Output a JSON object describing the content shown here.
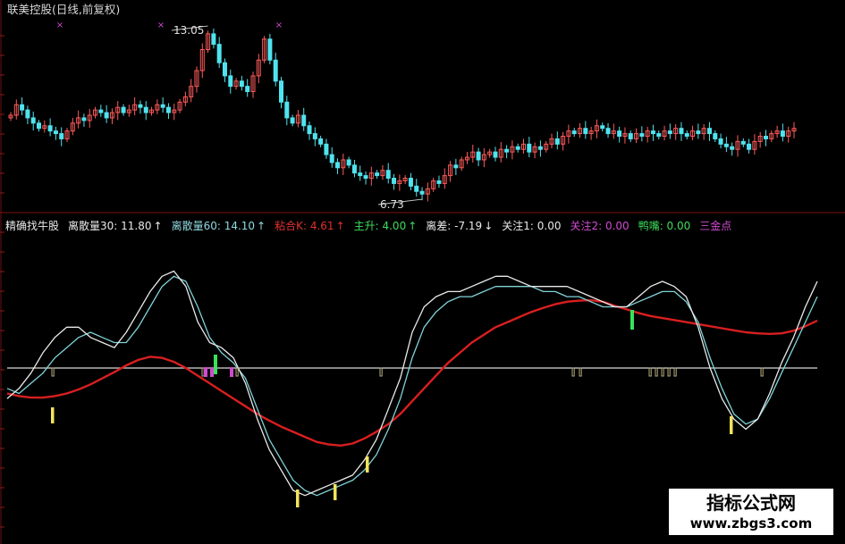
{
  "colors": {
    "background": "#000000",
    "divider": "#7a1212",
    "candle_up": "#ff5a5a",
    "candle_down": "#4fe3ef",
    "line_white": "#eaeaea",
    "line_cyan": "#7fd3d8",
    "line_red": "#d81f1f",
    "zero_line": "#d9d9d9",
    "tick_tan": "#b6ad7c",
    "mark_yellow": "#f2e35c",
    "mark_green": "#38e05c",
    "mark_magenta": "#d04ad0",
    "title_color": "#d8d8d8",
    "label_color": "#e0e0e0"
  },
  "price_panel": {
    "title": "联美控股(日线,前复权)",
    "high_label": "13.05",
    "low_label": "6.73",
    "marker_symbol": "×"
  },
  "indicator_bar": {
    "items": [
      {
        "text": "精确找牛股",
        "color": "#e8e8e8",
        "arrow": ""
      },
      {
        "text": "离散量30: 11.80",
        "color": "#e8e8e8",
        "arrow": "↑"
      },
      {
        "text": "离散量60: 14.10",
        "color": "#8fd9e0",
        "arrow": "↑"
      },
      {
        "text": "粘合K: 4.61",
        "color": "#e03030",
        "arrow": "↑"
      },
      {
        "text": "主升: 4.00",
        "color": "#3ddc5a",
        "arrow": "↑"
      },
      {
        "text": "离差: -7.19",
        "color": "#e8e8e8",
        "arrow": "↓"
      },
      {
        "text": "关注1: 0.00",
        "color": "#e8e8e8",
        "arrow": ""
      },
      {
        "text": "关注2: 0.00",
        "color": "#d04ad0",
        "arrow": ""
      },
      {
        "text": "鸭嘴: 0.00",
        "color": "#3ddc5a",
        "arrow": ""
      },
      {
        "text": "三金点",
        "color": "#d04ad0",
        "arrow": ""
      }
    ]
  },
  "watermark": {
    "name": "指标公式网",
    "url": "www.zbgs3.com"
  },
  "chart_data": [
    {
      "type": "candlestick",
      "title": "联美控股(日线,前复权)",
      "annotations": [
        {
          "label": "13.05",
          "value": 13.05,
          "kind": "high"
        },
        {
          "label": "6.73",
          "value": 6.73,
          "kind": "low"
        }
      ],
      "close_series": [
        9.9,
        10.3,
        10.1,
        9.8,
        9.6,
        9.4,
        9.5,
        9.3,
        9.2,
        9.0,
        9.3,
        9.6,
        9.8,
        9.7,
        9.9,
        10.1,
        10.0,
        9.8,
        10.0,
        10.2,
        10.0,
        10.1,
        10.3,
        10.2,
        10.0,
        10.1,
        10.3,
        10.2,
        10.0,
        10.1,
        10.4,
        10.6,
        11.0,
        11.6,
        12.4,
        13.0,
        12.6,
        11.9,
        11.4,
        11.0,
        11.2,
        11.0,
        10.8,
        11.4,
        12.0,
        12.8,
        12.0,
        11.2,
        10.4,
        9.8,
        9.6,
        9.9,
        9.5,
        9.2,
        9.0,
        8.8,
        8.4,
        8.1,
        7.9,
        8.2,
        8.0,
        7.7,
        7.6,
        7.5,
        7.7,
        7.6,
        7.8,
        7.5,
        7.3,
        7.4,
        7.5,
        7.2,
        7.0,
        6.9,
        7.1,
        7.4,
        7.3,
        7.6,
        8.0,
        7.9,
        8.2,
        8.3,
        8.5,
        8.2,
        8.4,
        8.5,
        8.3,
        8.6,
        8.5,
        8.7,
        8.6,
        8.8,
        8.5,
        8.7,
        8.6,
        8.8,
        9.0,
        8.8,
        9.1,
        9.3,
        9.2,
        9.4,
        9.2,
        9.3,
        9.5,
        9.4,
        9.2,
        9.3,
        9.1,
        9.2,
        9.0,
        9.2,
        9.1,
        9.3,
        9.2,
        9.1,
        9.3,
        9.2,
        9.4,
        9.2,
        9.1,
        9.3,
        9.2,
        9.4,
        9.2,
        9.0,
        8.8,
        8.7,
        8.6,
        8.9,
        8.8,
        8.6,
        8.9,
        9.1,
        9.0,
        9.2,
        9.3,
        9.1,
        9.3,
        9.4
      ]
    },
    {
      "type": "line",
      "title": "精确找牛股",
      "baseline": 0,
      "series": [
        {
          "name": "离散量30",
          "last_value": 11.8,
          "values": [
            -6,
            -4,
            -1,
            3,
            6,
            8,
            8,
            6,
            5,
            4,
            7,
            11,
            15,
            18,
            19,
            16,
            9,
            5,
            4,
            2,
            -3,
            -10,
            -16,
            -20,
            -24,
            -25,
            -24,
            -23,
            -22,
            -21,
            -18,
            -14,
            -8,
            -2,
            7,
            12,
            14,
            15,
            15,
            16,
            17,
            18,
            18,
            17,
            16,
            16,
            16,
            16,
            15,
            14,
            13,
            12,
            12,
            14,
            16,
            17,
            16,
            14,
            8,
            0,
            -6,
            -10,
            -12,
            -10,
            -5,
            1,
            6,
            12,
            17
          ]
        },
        {
          "name": "离散量60",
          "last_value": 14.1,
          "values": [
            -4,
            -5,
            -3,
            -1,
            2,
            4,
            6,
            7,
            6,
            5,
            5,
            8,
            12,
            16,
            18,
            17,
            12,
            6,
            3,
            1,
            -2,
            -8,
            -14,
            -18,
            -22,
            -24,
            -25,
            -24,
            -23,
            -22,
            -20,
            -17,
            -12,
            -6,
            2,
            8,
            11,
            13,
            14,
            14,
            15,
            16,
            16,
            16,
            16,
            15,
            15,
            14,
            14,
            13,
            12,
            12,
            12,
            13,
            14,
            15,
            15,
            13,
            9,
            2,
            -4,
            -9,
            -11,
            -10,
            -6,
            -1,
            4,
            9,
            14
          ]
        },
        {
          "name": "粘合K",
          "last_value": 4.61,
          "values": [
            -5,
            -5.5,
            -5.8,
            -5.8,
            -5.5,
            -5,
            -4.2,
            -3.2,
            -2,
            -0.8,
            0.5,
            1.6,
            2.2,
            2.0,
            1.2,
            0,
            -1.5,
            -3,
            -4.5,
            -6,
            -7.5,
            -9,
            -10.3,
            -11.5,
            -12.5,
            -13.5,
            -14.5,
            -15,
            -15.2,
            -14.8,
            -13.8,
            -12.5,
            -11,
            -9,
            -6.5,
            -4,
            -1.5,
            1,
            3,
            5,
            6.5,
            8,
            9,
            10,
            11,
            11.8,
            12.5,
            13,
            13.2,
            13.3,
            13,
            12.2,
            11.5,
            10.8,
            10.2,
            9.8,
            9.4,
            9,
            8.6,
            8.2,
            7.8,
            7.4,
            7,
            6.8,
            6.7,
            6.8,
            7.3,
            8.2,
            9.3
          ]
        },
        {
          "name": "主升",
          "last_value": 4.0
        },
        {
          "name": "离差",
          "last_value": -7.19
        },
        {
          "name": "关注1",
          "last_value": 0.0
        },
        {
          "name": "关注2",
          "last_value": 0.0
        },
        {
          "name": "鸭嘴",
          "last_value": 0.0
        }
      ]
    }
  ]
}
